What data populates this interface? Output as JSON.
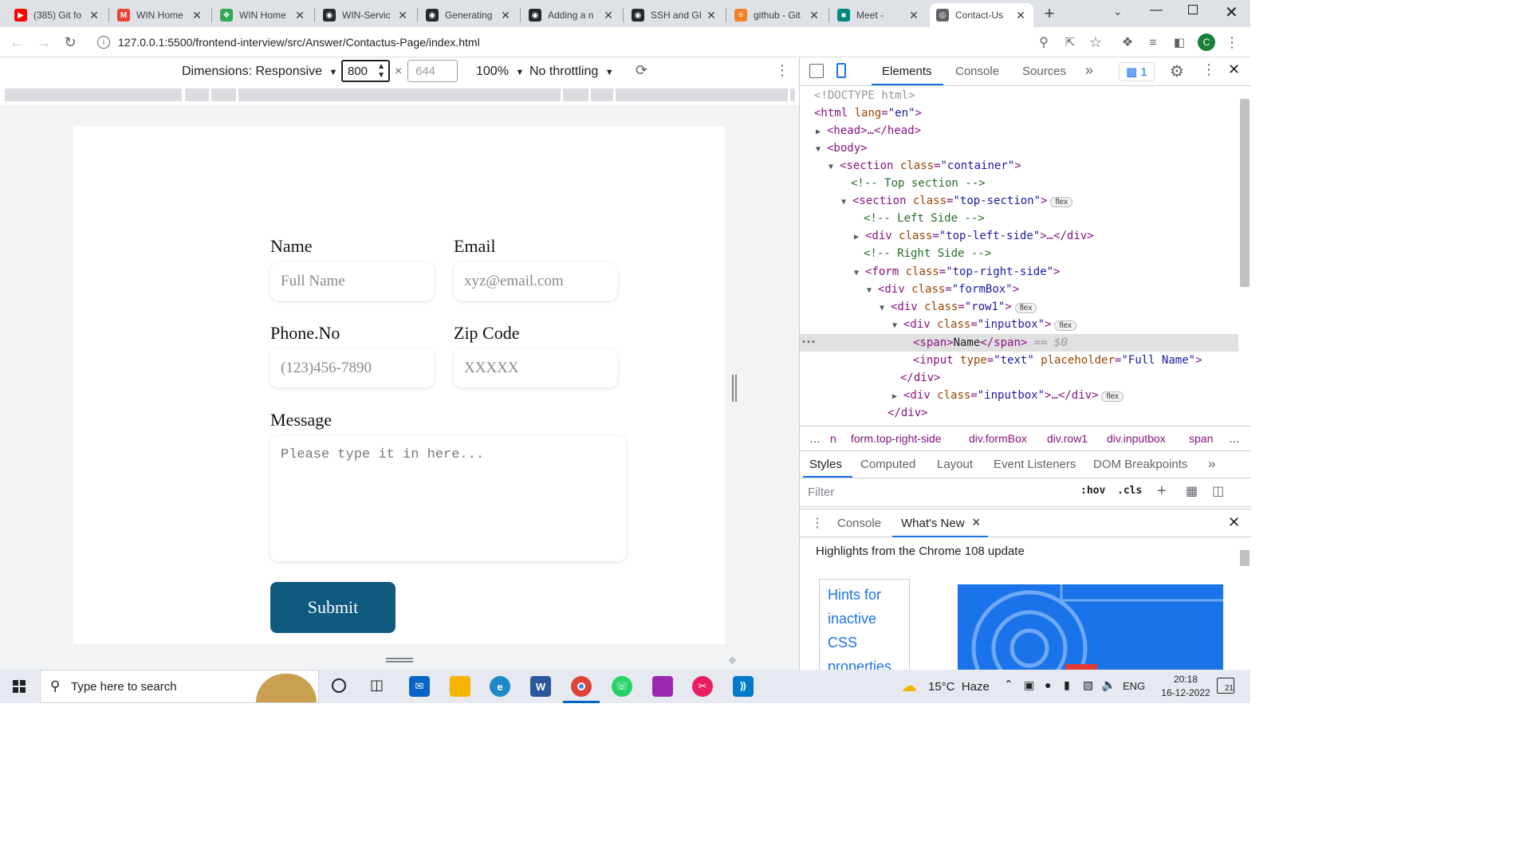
{
  "browser": {
    "tabs": [
      {
        "title": "(385) Git fo",
        "icon": "youtube-icon",
        "color": "#ff0000"
      },
      {
        "title": "WIN Home",
        "icon": "gmail-icon",
        "color": "#ea4335"
      },
      {
        "title": "WIN Home",
        "icon": "leaf-icon",
        "color": "#34a853"
      },
      {
        "title": "WIN-Servic",
        "icon": "github-icon",
        "color": "#24292f"
      },
      {
        "title": "Generating",
        "icon": "github-icon",
        "color": "#24292f"
      },
      {
        "title": "Adding a n",
        "icon": "github-icon",
        "color": "#24292f"
      },
      {
        "title": "SSH and GI",
        "icon": "github-icon",
        "color": "#24292f"
      },
      {
        "title": "github - Git",
        "icon": "stackoverflow-icon",
        "color": "#f48024"
      },
      {
        "title": "Meet -",
        "icon": "meet-icon",
        "color": "#00897b"
      },
      {
        "title": "Contact-Us",
        "icon": "globe-icon",
        "color": "#5f6368",
        "active": true
      }
    ],
    "url": "127.0.0.1:5500/frontend-interview/src/Answer/Contactus-Page/index.html",
    "profile_initial": "C"
  },
  "device_toolbar": {
    "dimensions_label": "Dimensions: Responsive",
    "width": "800",
    "height_placeholder": "644",
    "times": "×",
    "zoom": "100%",
    "throttling": "No throttling"
  },
  "form": {
    "name_label": "Name",
    "name_placeholder": "Full Name",
    "email_label": "Email",
    "email_placeholder": "xyz@email.com",
    "phone_label": "Phone.No",
    "phone_placeholder": "(123)456-7890",
    "zip_label": "Zip Code",
    "zip_placeholder": "XXXXX",
    "message_label": "Message",
    "message_placeholder": "Please type it in here...",
    "submit_label": "Submit"
  },
  "devtools": {
    "tabs": [
      "Elements",
      "Console",
      "Sources"
    ],
    "more": "»",
    "issues_count": "1",
    "dom": {
      "doctype": "<!DOCTYPE html>",
      "l_html_open": "<html",
      "l_html_lang": "lang",
      "l_html_lang_val": "\"en\"",
      "head": "<head>…</head>",
      "body": "<body>",
      "section_tag": "<section",
      "class_attr": "class",
      "container_val": "\"container\"",
      "top_comment": "<!-- Top section -->",
      "top_section_val": "\"top-section\"",
      "left_comment": "<!-- Left Side -->",
      "div_tag": "<div",
      "top_left_val": "\"top-left-side\"",
      "div_collapsed_end": ">…</div>",
      "right_comment": "<!-- Right Side -->",
      "form_tag": "<form",
      "top_right_val": "\"top-right-side\"",
      "formbox_val": "\"formBox\"",
      "row1_val": "\"row1\"",
      "inputbox_val": "\"inputbox\"",
      "span_open": "<span>",
      "span_text": "Name",
      "span_close": "</span>",
      "eq_dollar": " == $0",
      "input_tag": "<input",
      "type_attr": "type",
      "type_val": "\"text\"",
      "placeholder_attr": "placeholder",
      "placeholder_val": "\"Full Name\"",
      "div_close": "</div>",
      "gt": ">",
      "flex": "flex",
      "ellipsis": "•••"
    },
    "breadcrumbs": [
      "…",
      "n",
      "form.top-right-side",
      "div.formBox",
      "div.row1",
      "div.inputbox",
      "span",
      "…"
    ],
    "subtabs": [
      "Styles",
      "Computed",
      "Layout",
      "Event Listeners",
      "DOM Breakpoints"
    ],
    "filter_placeholder": "Filter",
    "hov": ":hov",
    "cls": ".cls",
    "drawer_tabs": [
      "Console",
      "What's New"
    ],
    "whats_new_close": "×",
    "highlights": "Highlights from the Chrome 108 update",
    "hints_text": [
      "Hints for",
      "inactive",
      "CSS",
      "properties"
    ]
  },
  "taskbar": {
    "search_placeholder": "Type here to search",
    "weather": "15°C  Haze",
    "language": "ENG",
    "time": "20:18",
    "date": "16-12-2022",
    "notifications": "21"
  }
}
